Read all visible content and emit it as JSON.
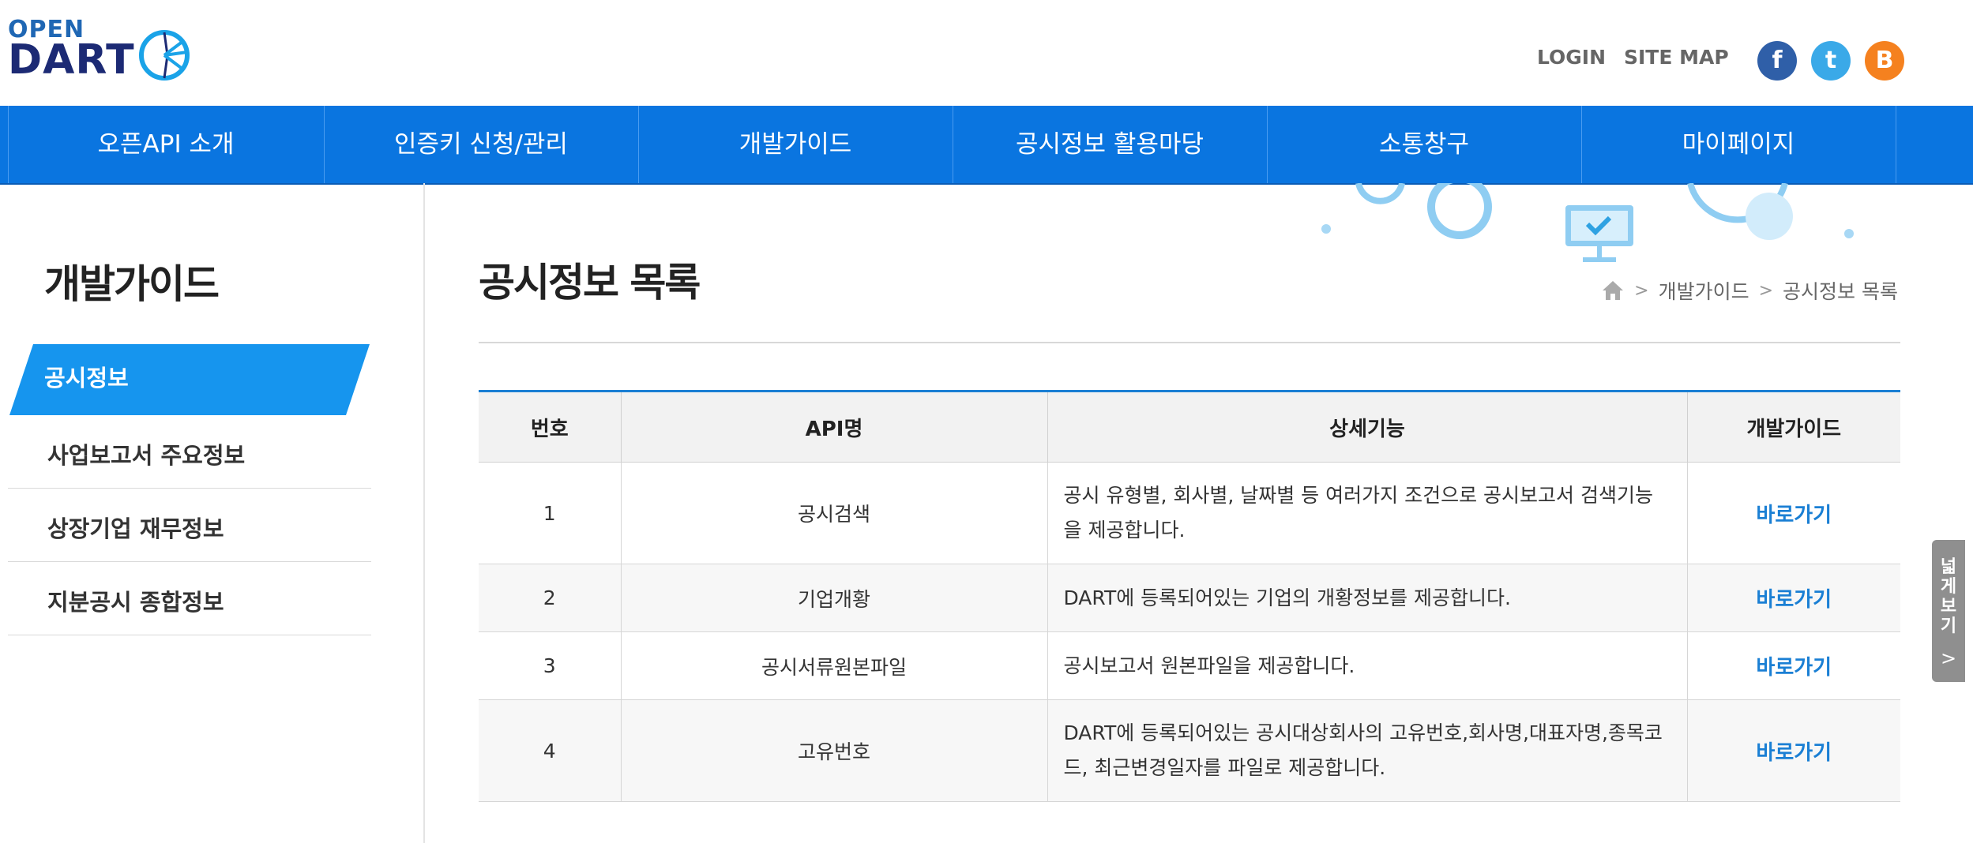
{
  "header": {
    "logo_open": "OPEN",
    "logo_dart": "DART",
    "login": "LOGIN",
    "sitemap": "SITE MAP",
    "sns": [
      {
        "icon": "facebook-icon",
        "glyph": "f",
        "color": "#2f5fa8"
      },
      {
        "icon": "twitter-icon",
        "glyph": "t",
        "color": "#3aa9e8"
      },
      {
        "icon": "blogger-icon",
        "glyph": "B",
        "color": "#f5811f"
      }
    ]
  },
  "nav": {
    "items": [
      "오픈API 소개",
      "인증키 신청/관리",
      "개발가이드",
      "공시정보 활용마당",
      "소통창구",
      "마이페이지"
    ]
  },
  "sidebar": {
    "title": "개발가이드",
    "items": [
      "공시정보",
      "사업보고서 주요정보",
      "상장기업 재무정보",
      "지분공시 종합정보"
    ]
  },
  "content": {
    "title": "공시정보 목록",
    "breadcrumb": [
      "개발가이드",
      "공시정보 목록"
    ]
  },
  "table": {
    "headers": [
      "번호",
      "API명",
      "상세기능",
      "개발가이드"
    ],
    "rows": [
      {
        "no": "1",
        "name": "공시검색",
        "desc": "공시 유형별, 회사별, 날짜별 등 여러가지 조건으로 공시보고서 검색기능을 제공합니다.",
        "link": "바로가기"
      },
      {
        "no": "2",
        "name": "기업개황",
        "desc": "DART에 등록되어있는 기업의 개황정보를 제공합니다.",
        "link": "바로가기"
      },
      {
        "no": "3",
        "name": "공시서류원본파일",
        "desc": "공시보고서 원본파일을 제공합니다.",
        "link": "바로가기"
      },
      {
        "no": "4",
        "name": "고유번호",
        "desc": "DART에 등록되어있는 공시대상회사의 고유번호,회사명,대표자명,종목코드, 최근변경일자를 파일로 제공합니다.",
        "link": "바로가기"
      }
    ]
  },
  "wide_view": {
    "label": "넓게보기"
  },
  "colors": {
    "nav": "#0a75e0",
    "active": "#1695ee",
    "link": "#1a7fd4",
    "table_border": "#1a7fd4"
  }
}
